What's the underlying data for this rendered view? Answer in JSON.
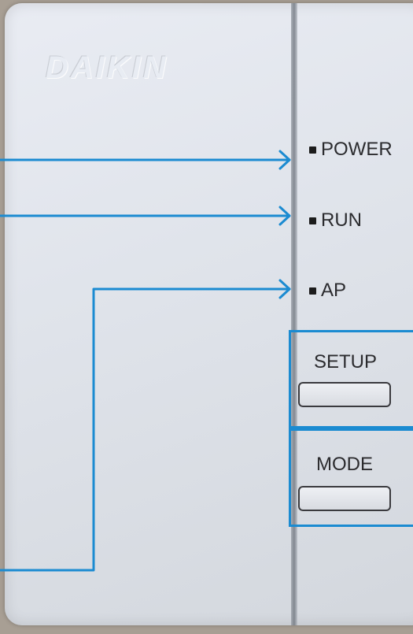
{
  "device": {
    "brand": "DAIKIN"
  },
  "indicators": [
    {
      "label": "POWER"
    },
    {
      "label": "RUN"
    },
    {
      "label": "AP"
    }
  ],
  "buttons": {
    "setup": {
      "label": "SETUP"
    },
    "mode": {
      "label": "MODE"
    }
  },
  "callouts": {
    "color": "#1b8bd1"
  }
}
